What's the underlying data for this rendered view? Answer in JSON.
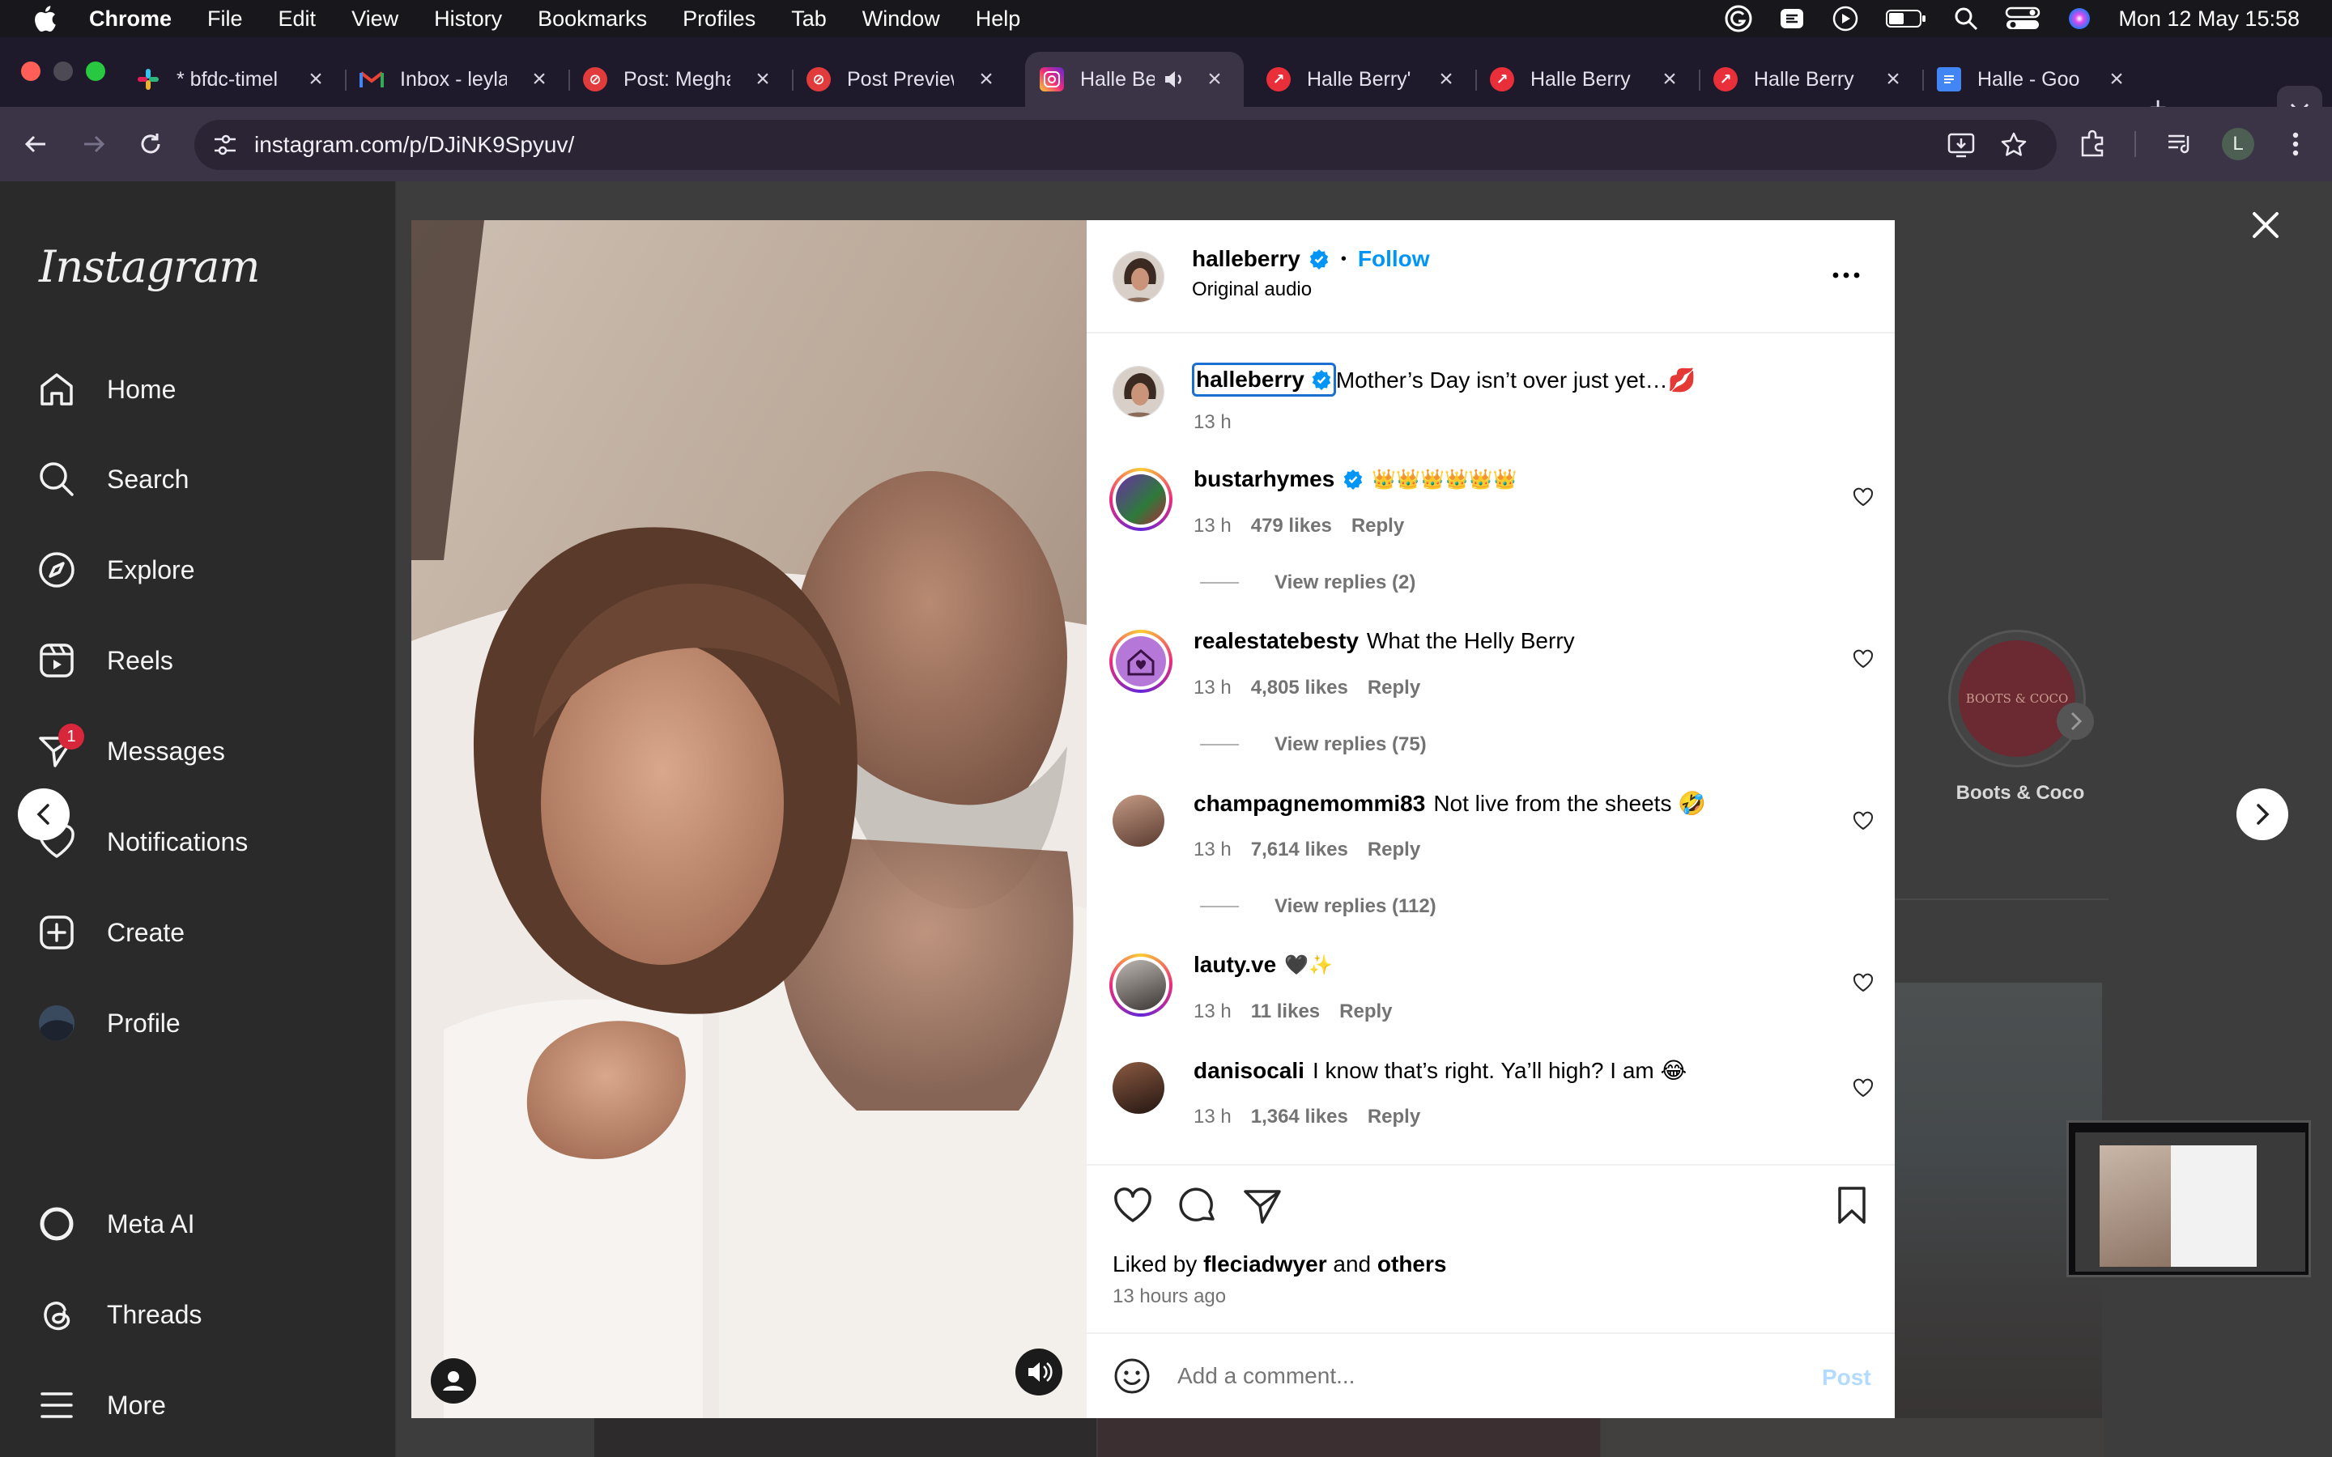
{
  "menubar": {
    "app": "Chrome",
    "items": [
      "File",
      "Edit",
      "View",
      "History",
      "Bookmarks",
      "Profiles",
      "Tab",
      "Window",
      "Help"
    ],
    "clock": "Mon 12 May  15:58"
  },
  "tabs": [
    {
      "label": "* bfdc-timel",
      "icon": "slack-icon"
    },
    {
      "label": "Inbox - leyla",
      "icon": "gmail-icon"
    },
    {
      "label": "Post: Megha",
      "icon": "post-icon"
    },
    {
      "label": "Post Preview",
      "icon": "post-icon"
    },
    {
      "label": "Halle Be",
      "icon": "instagram-icon",
      "active": true
    },
    {
      "label": "Halle Berry'",
      "icon": "trend-icon"
    },
    {
      "label": "Halle Berry",
      "icon": "trend-icon"
    },
    {
      "label": "Halle Berry",
      "icon": "trend-icon"
    },
    {
      "label": "Halle - Goo",
      "icon": "docs-icon"
    }
  ],
  "toolbar": {
    "url": "instagram.com/p/DJiNK9Spyuv/",
    "profile_initial": "L"
  },
  "sidebar": {
    "logo": "Instagram",
    "items": [
      {
        "label": "Home",
        "icon": "home-icon"
      },
      {
        "label": "Search",
        "icon": "search-icon"
      },
      {
        "label": "Explore",
        "icon": "compass-icon"
      },
      {
        "label": "Reels",
        "icon": "reels-icon"
      },
      {
        "label": "Messages",
        "icon": "messenger-icon",
        "badge": "1"
      },
      {
        "label": "Notifications",
        "icon": "heart-icon"
      },
      {
        "label": "Create",
        "icon": "plus-square-icon"
      },
      {
        "label": "Profile",
        "icon": "profile-avatar"
      }
    ],
    "bottom_items": [
      {
        "label": "Meta AI",
        "icon": "meta-ai-icon"
      },
      {
        "label": "Threads",
        "icon": "threads-icon"
      },
      {
        "label": "More",
        "icon": "menu-icon"
      }
    ]
  },
  "background": {
    "suggested_account": "Boots & Coco",
    "suggested_logo": "BOOTS & COCO"
  },
  "post": {
    "author": "halleberry",
    "follow_label": "Follow",
    "dot": "•",
    "audio": "Original audio",
    "caption": "Mother’s Day isn’t over just yet…💋",
    "caption_time": "13 h",
    "comments": [
      {
        "user": "bustarhymes",
        "verified": true,
        "text": "👑👑👑👑👑👑",
        "time": "13 h",
        "likes": "479 likes",
        "reply": "Reply",
        "view_replies": "View replies (2)"
      },
      {
        "user": "realestatebesty",
        "verified": false,
        "text": "What the Helly Berry",
        "time": "13 h",
        "likes": "4,805 likes",
        "reply": "Reply",
        "view_replies": "View replies (75)"
      },
      {
        "user": "champagnemommi83",
        "verified": false,
        "text": "Not live from the sheets 🤣",
        "time": "13 h",
        "likes": "7,614 likes",
        "reply": "Reply",
        "view_replies": "View replies (112)"
      },
      {
        "user": "lauty.ve",
        "verified": false,
        "text": "🖤✨",
        "time": "13 h",
        "likes": "11 likes",
        "reply": "Reply",
        "view_replies": ""
      },
      {
        "user": "danisocali",
        "verified": false,
        "text": "I know that’s right. Ya’ll high? I am 😂",
        "time": "13 h",
        "likes": "1,364 likes",
        "reply": "Reply",
        "view_replies": ""
      }
    ],
    "liked_by_prefix": "Liked by",
    "liked_by_user": "fleciadwyer",
    "liked_by_and": "and",
    "liked_by_others": "others",
    "posted_ago": "13 hours ago",
    "comment_placeholder": "Add a comment...",
    "post_button": "Post"
  },
  "colors": {
    "instagram_blue": "#0095f6",
    "verified_blue": "#0095f6",
    "badge_red": "#d8263b"
  }
}
